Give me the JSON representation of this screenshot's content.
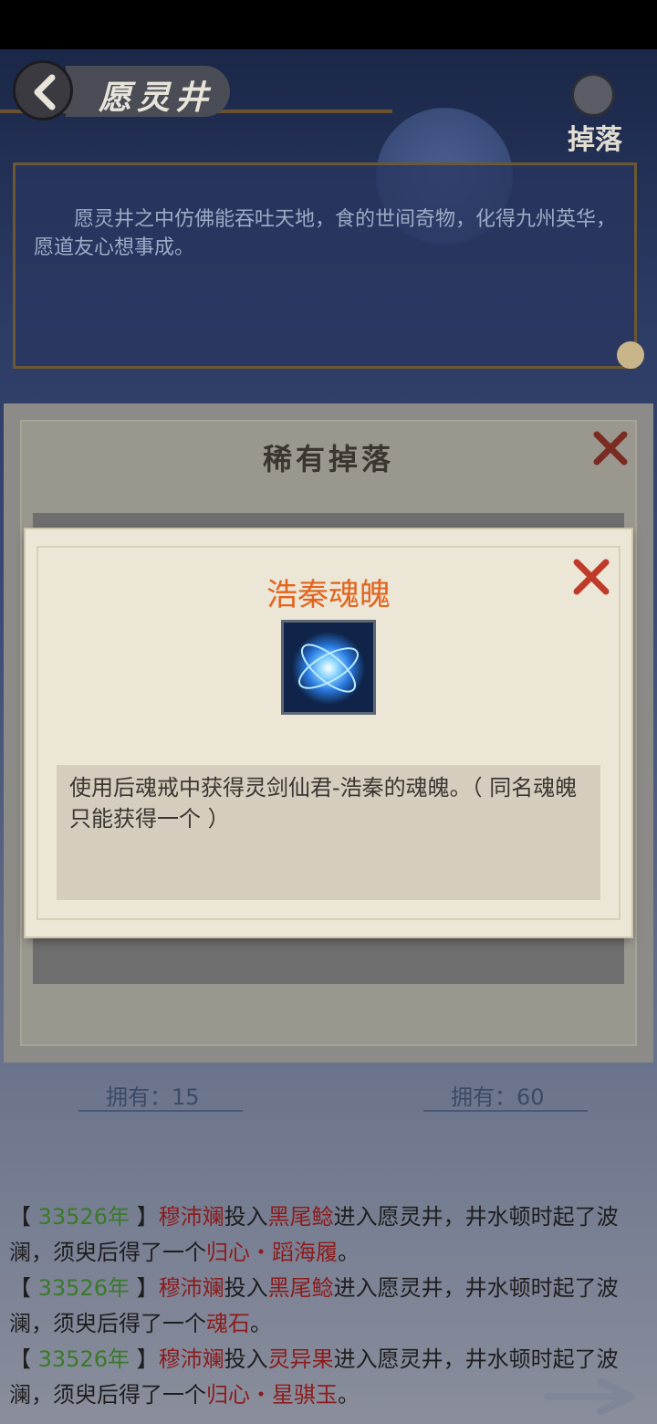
{
  "header": {
    "title": "愿灵井",
    "drops_label": "掉落"
  },
  "description": "愿灵井之中仿佛能吞吐天地，食的世间奇物，化得九州英华，愿道友心想事成。",
  "rare_panel": {
    "title": "稀有掉落",
    "owned": [
      "拥有：15",
      "拥有：60"
    ]
  },
  "item_popup": {
    "name": "浩秦魂魄",
    "icon": "blue-soul-orb",
    "description": "使用后魂戒中获得灵剑仙君-浩秦的魂魄。（ 同名魂魄只能获得一个 ）"
  },
  "log": [
    {
      "year": "33526年",
      "name": "穆沛斓",
      "verb": "投入",
      "offering": "黑尾鲶",
      "mid": "进入愿灵井，井水顿时起了波澜，须臾后得了一个",
      "result": "归心・蹈海履",
      "end": "。"
    },
    {
      "year": "33526年",
      "name": "穆沛斓",
      "verb": "投入",
      "offering": "黑尾鲶",
      "mid": "进入愿灵井，井水顿时起了波澜，须臾后得了一个",
      "result": "魂石",
      "end": "。"
    },
    {
      "year": "33526年",
      "name": "穆沛斓",
      "verb": "投入",
      "offering": "灵异果",
      "mid": "进入愿灵井，井水顿时起了波澜，须臾后得了一个",
      "result": "归心・星骐玉",
      "end": "。"
    }
  ],
  "colors": {
    "popup_title": "#e2641e",
    "log_year": "#3a7a2a",
    "log_highlight": "#8c1c1c"
  }
}
